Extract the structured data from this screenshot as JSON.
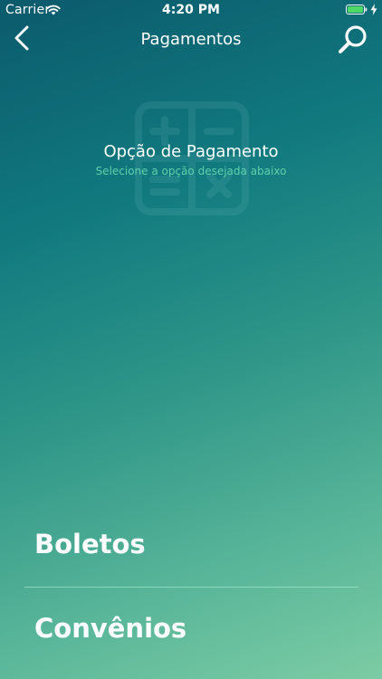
{
  "status_bar": {
    "carrier": "Carrier",
    "time": "4:20 PM"
  },
  "nav": {
    "title": "Pagamentos",
    "back_icon": "chevron-left-icon",
    "search_icon": "search-icon"
  },
  "header": {
    "title": "Opção de Pagamento",
    "subtitle": "Selecione a opção desejada abaixo",
    "icon": "calculator-icon"
  },
  "options": [
    {
      "label": "Boletos"
    },
    {
      "label": "Convênios"
    }
  ],
  "colors": {
    "gradient_top": "#0b5a6c",
    "gradient_bottom": "#7ccca4",
    "subtitle": "#5ed1ab",
    "battery": "#4cd964"
  }
}
